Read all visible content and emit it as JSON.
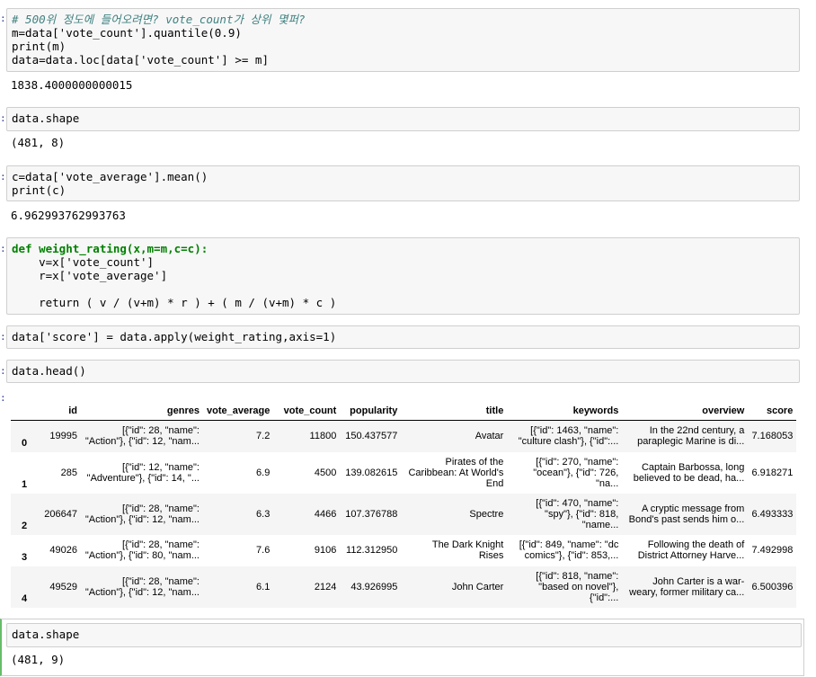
{
  "cells": [
    {
      "lines": [
        "# 500위 정도에 들어오려면? vote_count가 상위 몇퍼?",
        "m=data['vote_count'].quantile(0.9)",
        "print(m)",
        "data=data.loc[data['vote_count'] >= m]"
      ],
      "output": "1838.4000000000015"
    },
    {
      "lines": [
        "data.shape"
      ],
      "output": "(481, 8)"
    },
    {
      "lines": [
        "c=data['vote_average'].mean()",
        "print(c)"
      ],
      "output": "6.962993762993763"
    },
    {
      "lines": [
        "def weight_rating(x,m=m,c=c):",
        "    v=x['vote_count']",
        "    r=x['vote_average']",
        "",
        "    return ( v / (v+m) * r ) + ( m / (v+m) * c )"
      ]
    },
    {
      "lines": [
        "data['score'] = data.apply(weight_rating,axis=1)"
      ]
    },
    {
      "lines": [
        "data.head()"
      ]
    },
    {
      "lines": [
        "data.shape"
      ],
      "output": "(481, 9)"
    }
  ],
  "dataframe": {
    "columns": [
      "",
      "id",
      "genres",
      "vote_average",
      "vote_count",
      "popularity",
      "title",
      "keywords",
      "overview",
      "score"
    ],
    "rows": [
      {
        "index": "0",
        "id": "19995",
        "genres": "[{\"id\": 28, \"name\": \"Action\"}, {\"id\": 12, \"nam...",
        "vote_average": "7.2",
        "vote_count": "11800",
        "popularity": "150.437577",
        "title": "Avatar",
        "keywords": "[{\"id\": 1463, \"name\": \"culture clash\"}, {\"id\":...",
        "overview": "In the 22nd century, a paraplegic Marine is di...",
        "score": "7.168053"
      },
      {
        "index": "1",
        "id": "285",
        "genres": "[{\"id\": 12, \"name\": \"Adventure\"}, {\"id\": 14, \"...",
        "vote_average": "6.9",
        "vote_count": "4500",
        "popularity": "139.082615",
        "title": "Pirates of the Caribbean: At World's End",
        "keywords": "[{\"id\": 270, \"name\": \"ocean\"}, {\"id\": 726, \"na...",
        "overview": "Captain Barbossa, long believed to be dead, ha...",
        "score": "6.918271"
      },
      {
        "index": "2",
        "id": "206647",
        "genres": "[{\"id\": 28, \"name\": \"Action\"}, {\"id\": 12, \"nam...",
        "vote_average": "6.3",
        "vote_count": "4466",
        "popularity": "107.376788",
        "title": "Spectre",
        "keywords": "[{\"id\": 470, \"name\": \"spy\"}, {\"id\": 818, \"name...",
        "overview": "A cryptic message from Bond's past sends him o...",
        "score": "6.493333"
      },
      {
        "index": "3",
        "id": "49026",
        "genres": "[{\"id\": 28, \"name\": \"Action\"}, {\"id\": 80, \"nam...",
        "vote_average": "7.6",
        "vote_count": "9106",
        "popularity": "112.312950",
        "title": "The Dark Knight Rises",
        "keywords": "[{\"id\": 849, \"name\": \"dc comics\"}, {\"id\": 853,...",
        "overview": "Following the death of District Attorney Harve...",
        "score": "7.492998"
      },
      {
        "index": "4",
        "id": "49529",
        "genres": "[{\"id\": 28, \"name\": \"Action\"}, {\"id\": 12, \"nam...",
        "vote_average": "6.1",
        "vote_count": "2124",
        "popularity": "43.926995",
        "title": "John Carter",
        "keywords": "[{\"id\": 818, \"name\": \"based on novel\"}, {\"id\":...",
        "overview": "John Carter is a war-weary, former military ca...",
        "score": "6.500396"
      }
    ]
  }
}
